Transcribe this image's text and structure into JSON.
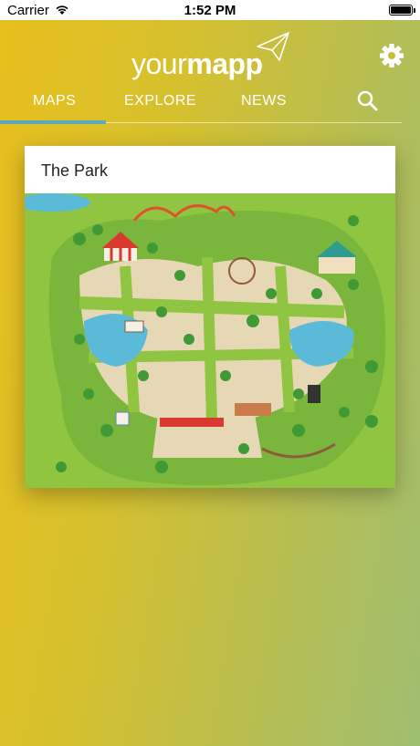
{
  "status_bar": {
    "carrier": "Carrier",
    "time": "1:52 PM",
    "battery": 1.0
  },
  "header": {
    "logo_light": "your",
    "logo_bold": "mapp",
    "settings_icon": "gear-icon"
  },
  "tabs": [
    {
      "label": "MAPS",
      "active": true
    },
    {
      "label": "EXPLORE",
      "active": false
    },
    {
      "label": "NEWS",
      "active": false
    }
  ],
  "search_icon": "search-icon",
  "colors": {
    "tab_indicator": "#5aa9bf",
    "gradient_start": "#e8bf1d",
    "gradient_end": "#9fbe71"
  },
  "cards": [
    {
      "title": "The Park",
      "image": "park-map-illustration"
    }
  ]
}
